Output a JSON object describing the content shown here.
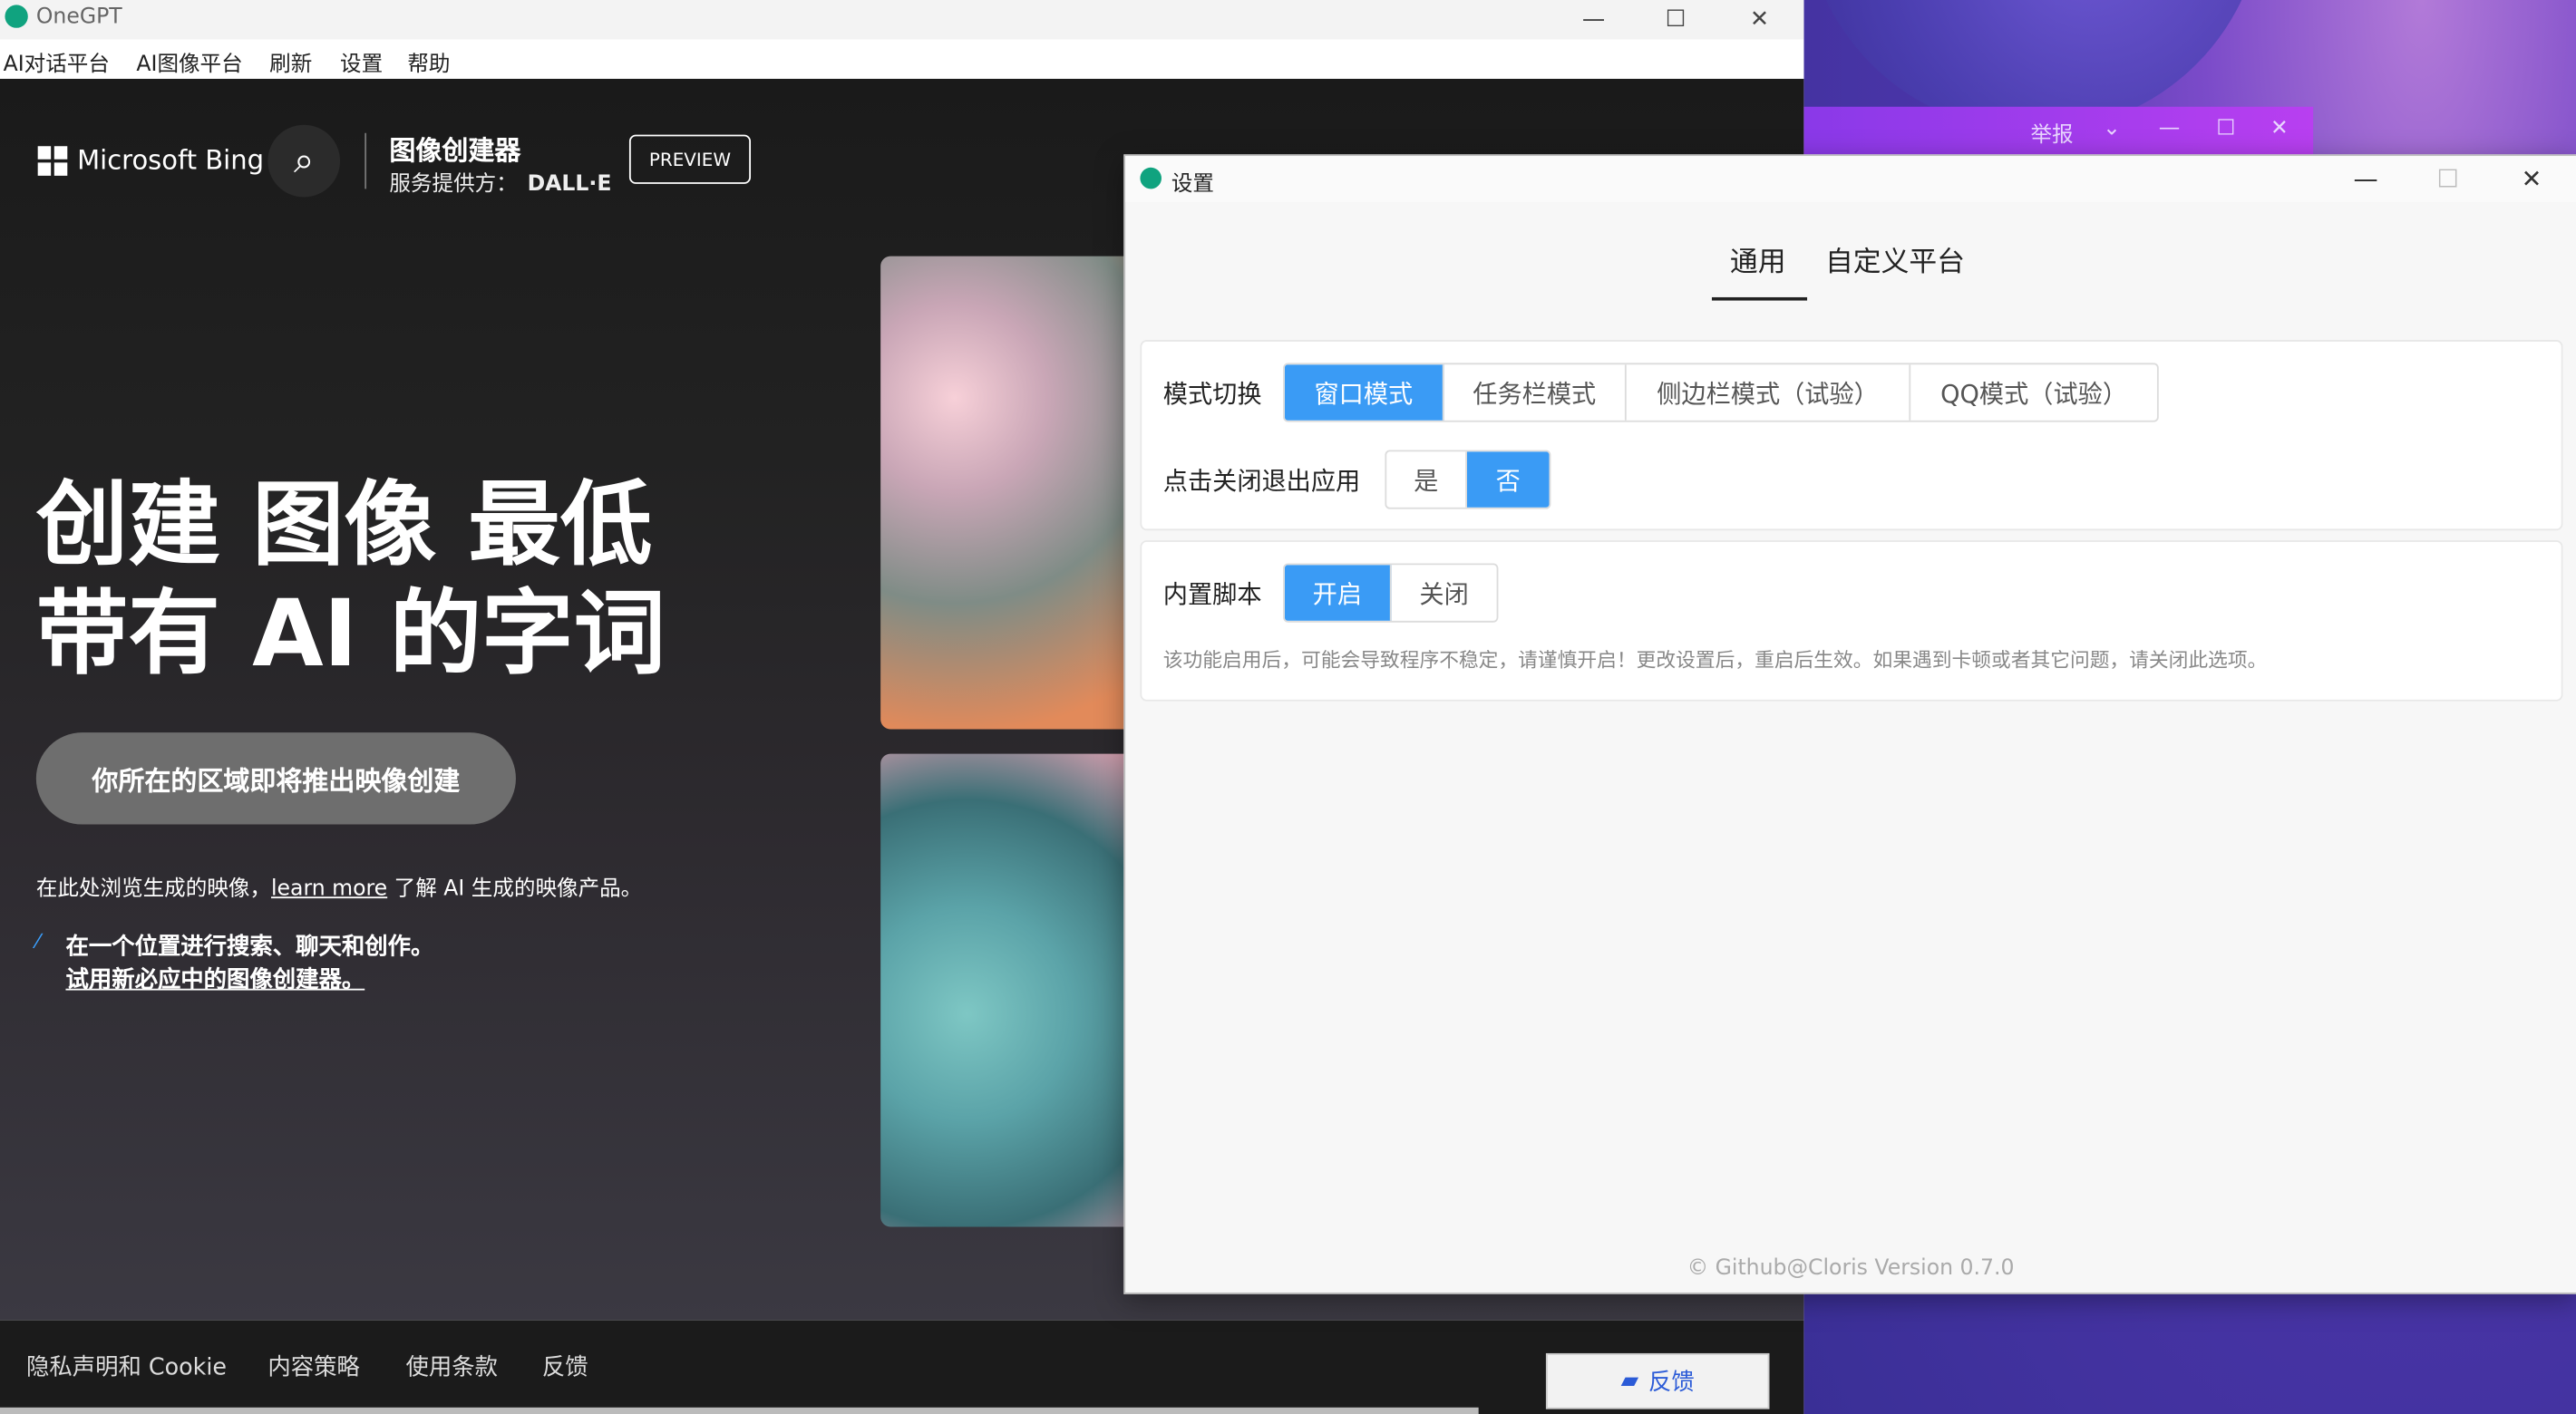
{
  "app": {
    "title": "OneGPT",
    "menu": [
      "AI对话平台",
      "AI图像平台",
      "刷新",
      "设置",
      "帮助"
    ]
  },
  "bing": {
    "brand": "Microsoft Bing",
    "creator_title": "图像创建器",
    "provider_label": "服务提供方：",
    "provider_name": "DALL·E",
    "preview": "PREVIEW",
    "hero_line1": "创建 图像 最低",
    "hero_line2": "带有 AI 的字词",
    "region_button": "你所在的区域即将推出映像创建",
    "browse_prefix": "在此处浏览生成的映像，",
    "learn_more": "learn more",
    "browse_suffix": " 了解 AI 生成的映像产品。",
    "tip_line1": "在一个位置进行搜索、聊天和创作。",
    "tip_line2": "试用新必应中的图像创建器。",
    "footer_links": [
      "隐私声明和 Cookie",
      "内容策略",
      "使用条款",
      "反馈"
    ],
    "feedback_button": "反馈"
  },
  "background_window": {
    "report": "举报"
  },
  "settings": {
    "title": "设置",
    "tabs": [
      {
        "label": "通用",
        "active": true
      },
      {
        "label": "自定义平台",
        "active": false
      }
    ],
    "mode_label": "模式切换",
    "mode_options": [
      "窗口模式",
      "任务栏模式",
      "侧边栏模式（试验）",
      "QQ模式（试验）"
    ],
    "mode_selected": "窗口模式",
    "close_label": "点击关闭退出应用",
    "close_options": [
      "是",
      "否"
    ],
    "close_selected": "否",
    "script_label": "内置脚本",
    "script_options": [
      "开启",
      "关闭"
    ],
    "script_selected": "开启",
    "script_note": "该功能启用后，可能会导致程序不稳定，请谨慎开启！更改设置后，重启后生效。如果遇到卡顿或者其它问题，请关闭此选项。",
    "version": "© Github@Cloris Version 0.7.0"
  },
  "colors": {
    "accent": "#3a9bf5",
    "app_icon": "#10a37f"
  }
}
